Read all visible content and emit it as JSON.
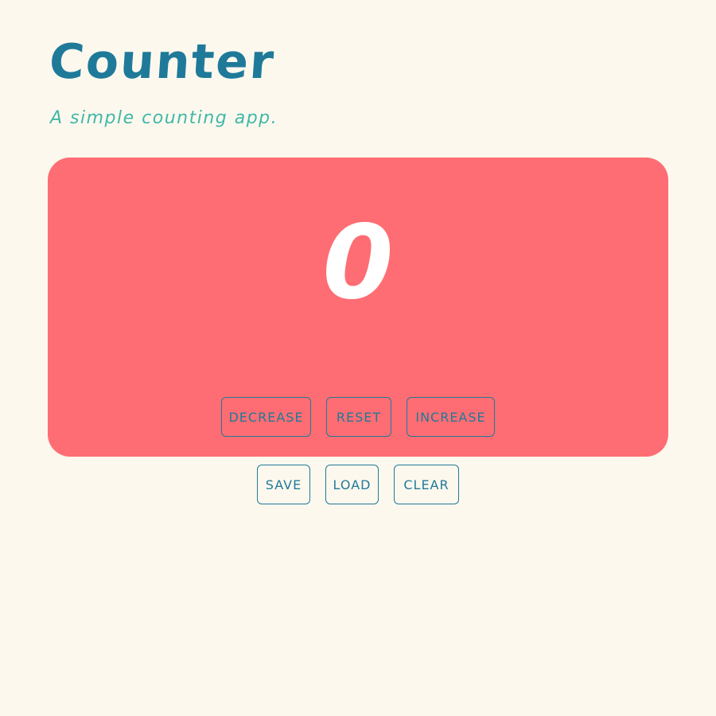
{
  "header": {
    "title": "Counter",
    "subtitle": "A simple counting app."
  },
  "counter": {
    "value": "0"
  },
  "controls": {
    "decrease_label": "Decrease",
    "reset_label": "Reset",
    "increase_label": "Increase"
  },
  "storage": {
    "save_label": "Save",
    "load_label": "Load",
    "clear_label": "Clear"
  },
  "colors": {
    "background": "#fdf8ee",
    "primary": "#1f7a99",
    "accent": "#3fb8a8",
    "card": "#fe6d73",
    "counter_text": "#ffffff"
  }
}
